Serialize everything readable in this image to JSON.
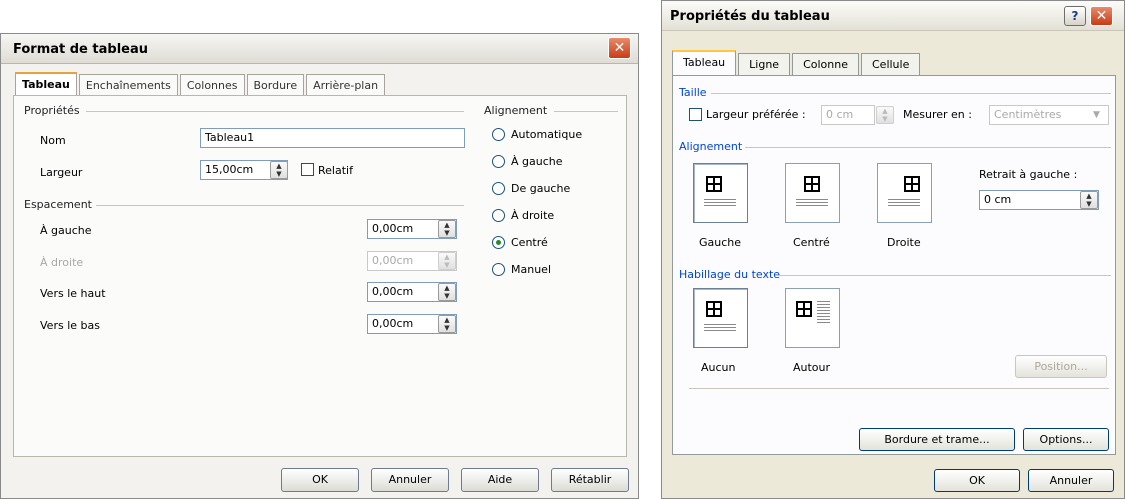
{
  "dialog_left": {
    "title": "Format de tableau",
    "tabs": [
      "Tableau",
      "Enchaînements",
      "Colonnes",
      "Bordure",
      "Arrière-plan"
    ],
    "properties": {
      "heading": "Propriétés",
      "name_label": "Nom",
      "name_value": "Tableau1",
      "width_label": "Largeur",
      "width_value": "15,00cm",
      "relative_label": "Relatif"
    },
    "spacing": {
      "heading": "Espacement",
      "left_label": "À gauche",
      "left_value": "0,00cm",
      "right_label": "À droite",
      "right_value": "0,00cm",
      "top_label": "Vers le haut",
      "top_value": "0,00cm",
      "bottom_label": "Vers le bas",
      "bottom_value": "0,00cm"
    },
    "alignment": {
      "heading": "Alignement",
      "options": [
        "Automatique",
        "À gauche",
        "De gauche",
        "À droite",
        "Centré",
        "Manuel"
      ],
      "selected": "Centré"
    },
    "buttons": {
      "ok": "OK",
      "cancel": "Annuler",
      "help": "Aide",
      "reset": "Rétablir"
    }
  },
  "dialog_right": {
    "title": "Propriétés du tableau",
    "help_glyph": "?",
    "tabs": [
      "Tableau",
      "Ligne",
      "Colonne",
      "Cellule"
    ],
    "size": {
      "heading": "Taille",
      "preferred_width_label": "Largeur préférée :",
      "preferred_width_value": "0 cm",
      "measure_label": "Mesurer en :",
      "measure_value": "Centimètres"
    },
    "alignment": {
      "heading": "Alignement",
      "options": [
        "Gauche",
        "Centré",
        "Droite"
      ],
      "selected": "Gauche",
      "indent_label": "Retrait à gauche :",
      "indent_value": "0 cm"
    },
    "wrapping": {
      "heading": "Habillage du texte",
      "options": [
        "Aucun",
        "Autour"
      ],
      "selected": "Aucun",
      "position_button": "Position..."
    },
    "buttons": {
      "borders": "Bordure et trame...",
      "options": "Options...",
      "ok": "OK",
      "cancel": "Annuler"
    }
  }
}
